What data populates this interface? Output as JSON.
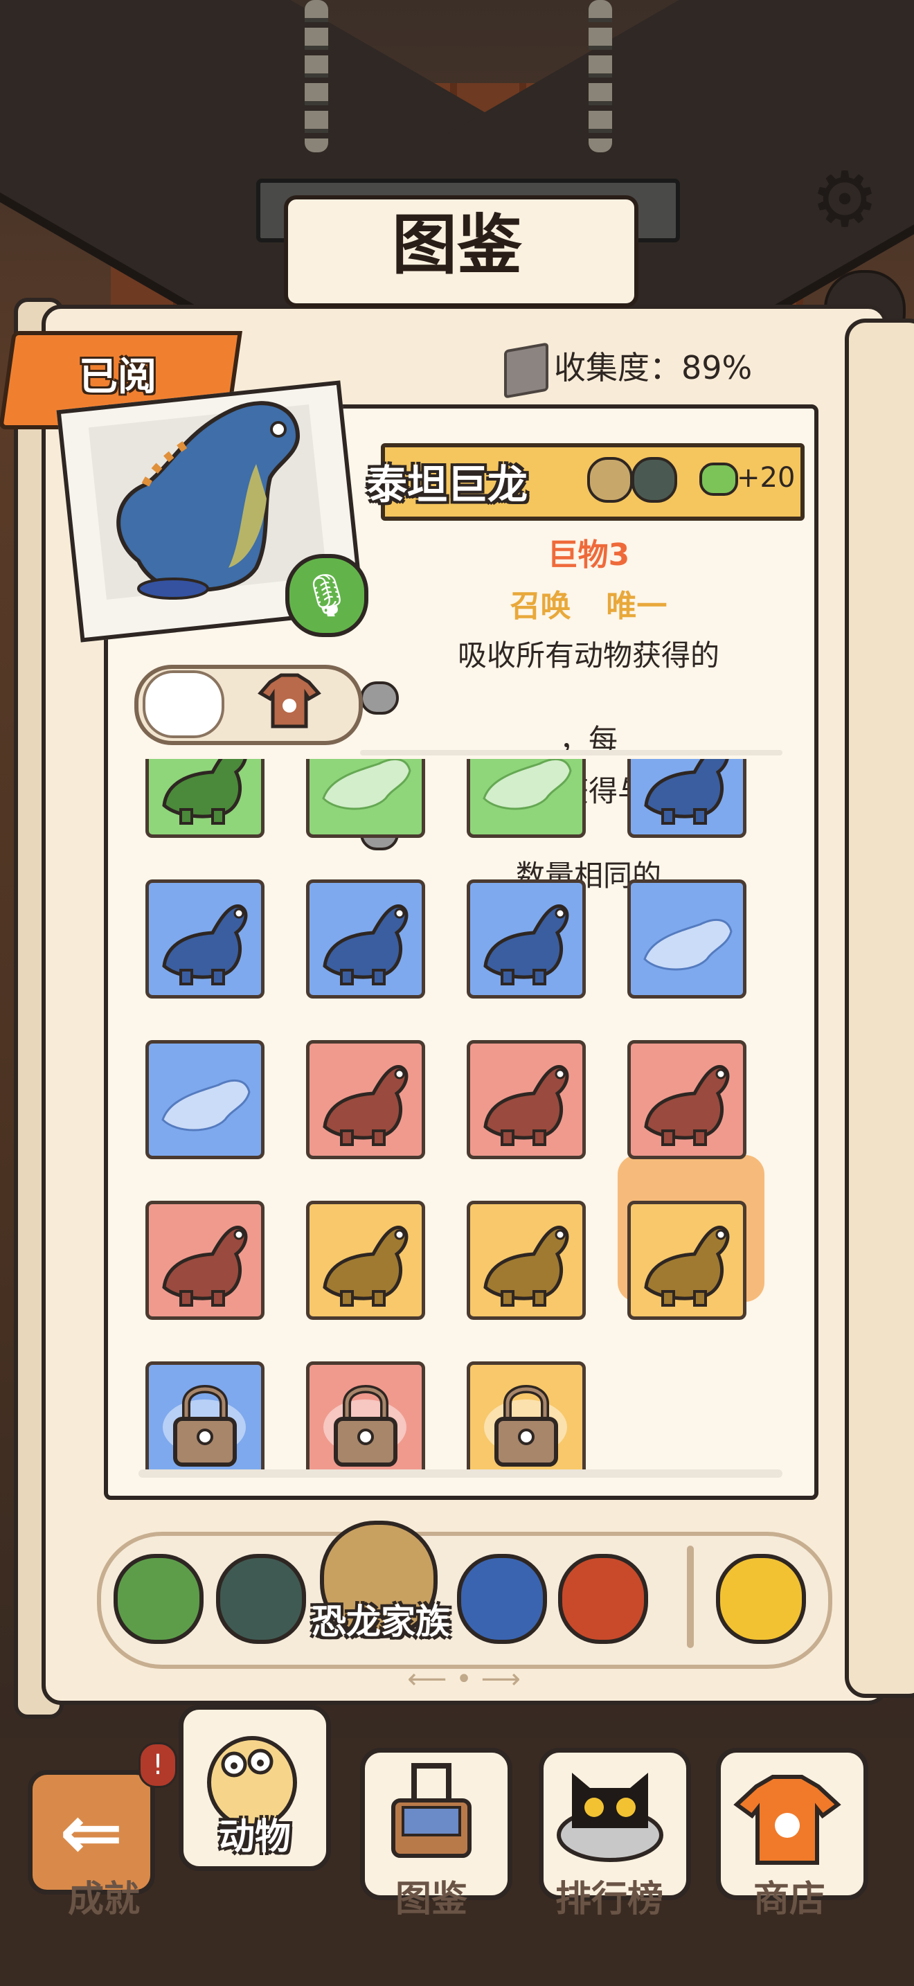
{
  "title": "图鉴",
  "tab_label": "已阅",
  "collection": "收集度：89%",
  "detail": {
    "name": "泰坦巨龙",
    "bonus": "+20",
    "type": "巨物3",
    "summon_label": "召唤",
    "summon_value": "唯一",
    "description_1a": "吸收所有动物获得的",
    "description_1b": "，每",
    "description_2a": "天获得与",
    "description_2b": "数量相同的"
  },
  "grid": [
    {
      "color": "green",
      "icon": "dino-partial-1",
      "locked": false
    },
    {
      "color": "green",
      "icon": "dino-silhouette",
      "locked": false
    },
    {
      "color": "green",
      "icon": "dino-silhouette",
      "locked": false
    },
    {
      "color": "blue",
      "icon": "dino-partial-2",
      "locked": false
    },
    {
      "color": "blue",
      "icon": "dilophosaurus-icon",
      "locked": false
    },
    {
      "color": "blue",
      "icon": "therizinosaurus-icon",
      "locked": false
    },
    {
      "color": "blue",
      "icon": "diplodocus-icon",
      "locked": false
    },
    {
      "color": "blue",
      "icon": "dino-silhouette",
      "locked": false
    },
    {
      "color": "blue",
      "icon": "pterosaur-silhouette",
      "locked": false
    },
    {
      "color": "red",
      "icon": "ankylosaurus-icon",
      "locked": false
    },
    {
      "color": "red",
      "icon": "brachiosaurus-icon",
      "locked": false
    },
    {
      "color": "red",
      "icon": "apatosaurus-icon",
      "locked": false
    },
    {
      "color": "red",
      "icon": "triceratops-icon",
      "locked": false
    },
    {
      "color": "yellow",
      "icon": "pteranodon-icon",
      "locked": false
    },
    {
      "color": "yellow",
      "icon": "t-rex-icon",
      "locked": false
    },
    {
      "color": "yellow",
      "icon": "titanosaur-icon",
      "locked": false,
      "selected": true
    },
    {
      "color": "blue",
      "icon": "lock-icon",
      "locked": true
    },
    {
      "color": "red",
      "icon": "lock-icon",
      "locked": true
    },
    {
      "color": "yellow",
      "icon": "lock-icon",
      "locked": true
    }
  ],
  "category_label": "恐龙家族",
  "page_indicator": "⟵ • ⟶",
  "nav": {
    "animals": "动物",
    "achievements": "成就",
    "codex": "图鉴",
    "ranking": "排行榜",
    "shop": "商店",
    "badge": "!"
  },
  "colors": {
    "tab": "#f08030",
    "name_bar": "#f5c65e",
    "type": "#ef6a3a",
    "summon": "#e8a83a",
    "green": "#8fd57a",
    "blue": "#7ea9ee",
    "red": "#f09a8e",
    "yellow": "#f8c86a"
  }
}
